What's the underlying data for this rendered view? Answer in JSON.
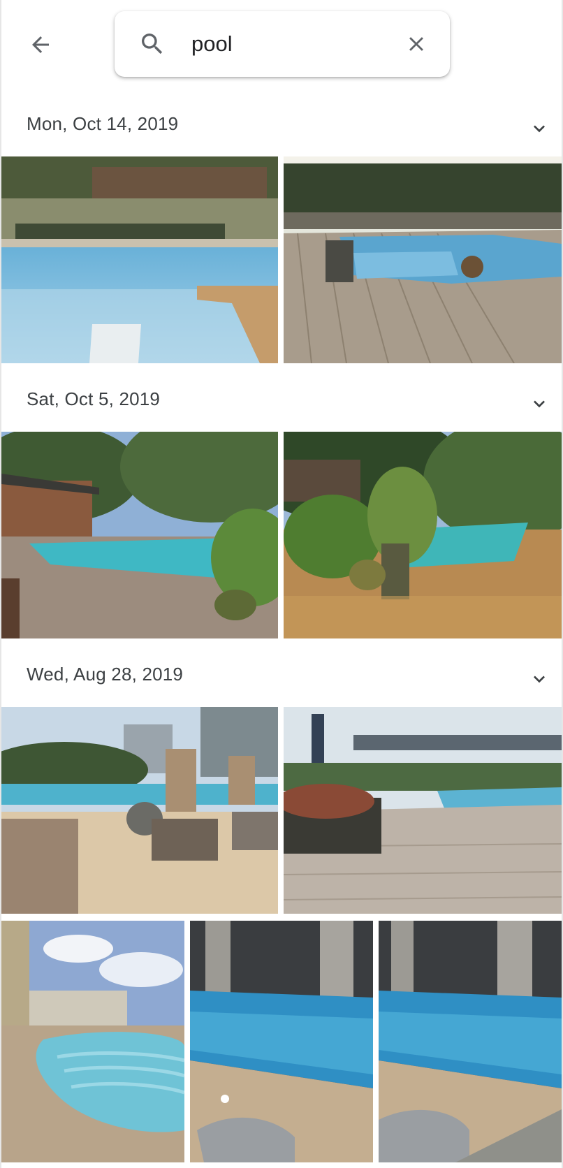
{
  "header": {
    "back_icon": "arrow-left-icon",
    "search": {
      "icon": "search-icon",
      "value": "pool",
      "clear_icon": "close-icon"
    }
  },
  "sections": [
    {
      "date": "Mon, Oct 14, 2019",
      "toggle_icon": "chevron-down-icon",
      "photos": 2
    },
    {
      "date": "Sat, Oct 5, 2019",
      "toggle_icon": "chevron-down-icon",
      "photos": 2
    },
    {
      "date": "Wed, Aug 28, 2019",
      "toggle_icon": "chevron-down-icon",
      "photos": 5
    }
  ],
  "colors": {
    "text_primary": "#202124",
    "text_date": "#3c4043",
    "icon_grey": "#5f6368",
    "pool_blue": "#6ab3d6",
    "background": "#ffffff"
  }
}
